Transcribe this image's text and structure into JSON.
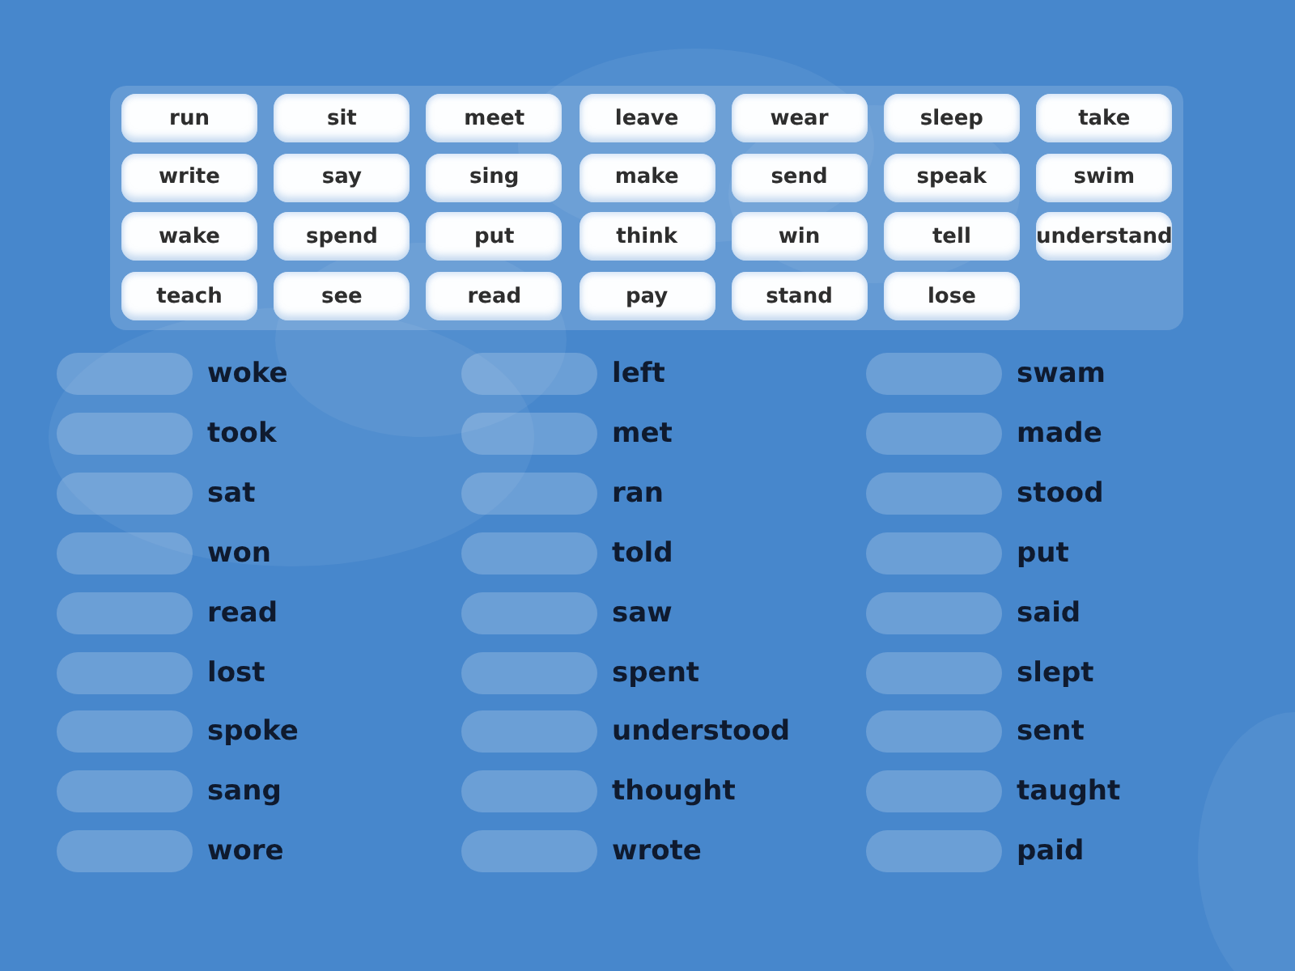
{
  "word_bank": {
    "tiles": [
      "run",
      "sit",
      "meet",
      "leave",
      "wear",
      "sleep",
      "take",
      "write",
      "say",
      "sing",
      "make",
      "send",
      "speak",
      "swim",
      "wake",
      "spend",
      "put",
      "think",
      "win",
      "tell",
      "understand",
      "teach",
      "see",
      "read",
      "pay",
      "stand",
      "lose"
    ]
  },
  "answer_columns": [
    {
      "answers": [
        "woke",
        "took",
        "sat",
        "won",
        "read",
        "lost",
        "spoke",
        "sang",
        "wore"
      ]
    },
    {
      "answers": [
        "left",
        "met",
        "ran",
        "told",
        "saw",
        "spent",
        "understood",
        "thought",
        "wrote"
      ]
    },
    {
      "answers": [
        "swam",
        "made",
        "stood",
        "put",
        "said",
        "slept",
        "sent",
        "taught",
        "paid"
      ]
    }
  ]
}
